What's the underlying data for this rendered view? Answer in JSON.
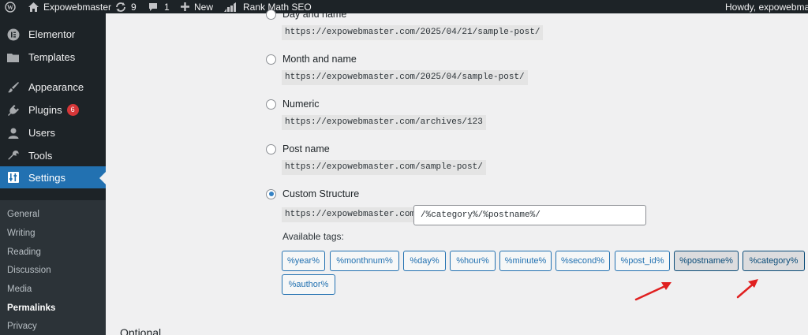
{
  "adminbar": {
    "site_name": "Expowebmaster",
    "updates_count": "9",
    "comments_count": "1",
    "new_label": "New",
    "rank_math_label": "Rank Math SEO",
    "howdy": "Howdy, expowebmast"
  },
  "sidebar": {
    "items": [
      {
        "label": "Elementor",
        "icon": "elementor-icon"
      },
      {
        "label": "Templates",
        "icon": "folder-icon"
      },
      {
        "label": "Appearance",
        "icon": "brush-icon"
      },
      {
        "label": "Plugins",
        "icon": "plug-icon",
        "badge": "6"
      },
      {
        "label": "Users",
        "icon": "user-icon"
      },
      {
        "label": "Tools",
        "icon": "wrench-icon"
      },
      {
        "label": "Settings",
        "icon": "settings-icon",
        "current": true
      }
    ],
    "submenu": [
      "General",
      "Writing",
      "Reading",
      "Discussion",
      "Media",
      "Permalinks",
      "Privacy"
    ],
    "submenu_current": "Permalinks"
  },
  "permalinks": {
    "options": [
      {
        "label": "Day and name",
        "example": "https://expowebmaster.com/2025/04/21/sample-post/"
      },
      {
        "label": "Month and name",
        "example": "https://expowebmaster.com/2025/04/sample-post/"
      },
      {
        "label": "Numeric",
        "example": "https://expowebmaster.com/archives/123"
      },
      {
        "label": "Post name",
        "example": "https://expowebmaster.com/sample-post/"
      },
      {
        "label": "Custom Structure",
        "example": "https://expowebmaster.com",
        "checked": true
      }
    ],
    "custom_structure_value": "/%category%/%postname%/",
    "available_tags_label": "Available tags:",
    "tags": [
      "%year%",
      "%monthnum%",
      "%day%",
      "%hour%",
      "%minute%",
      "%second%",
      "%post_id%",
      "%postname%",
      "%category%",
      "%author%"
    ],
    "active_tags": [
      "%postname%",
      "%category%"
    ]
  },
  "optional_heading": "Optional",
  "colors": {
    "admin_dark": "#1d2327",
    "accent_blue": "#2271b1",
    "badge_red": "#d63638",
    "arrow_red": "#e02020"
  }
}
